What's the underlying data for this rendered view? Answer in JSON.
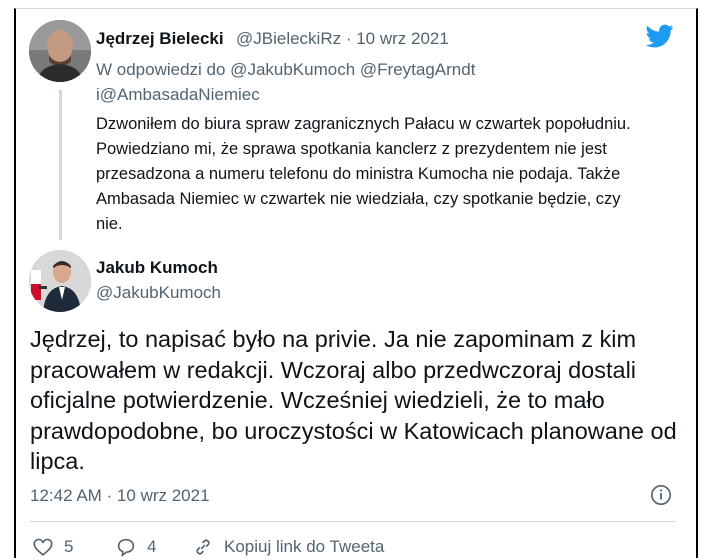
{
  "reply_tweet": {
    "author_name": "Jędrzej Bielecki",
    "meta": "@JBieleckiRz · 10 wrz 2021",
    "reply_line1": "W odpowiedzi do @JakubKumoch @FreytagArndt",
    "reply_line2": "i@AmbasadaNiemiec",
    "text": "Dzwoniłem do biura spraw zagranicznych Pałacu w czwartek popołudniu. Powiedziano mi, że sprawa spotkania kanclerz z prezydentem nie jest przesadzona a numeru telefonu do ministra Kumocha nie podaja. Także Ambasada Niemiec w czwartek nie wiedziała, czy spotkanie będzie, czy nie."
  },
  "main_tweet": {
    "author_name": "Jakub Kumoch",
    "handle": "@JakubKumoch",
    "text": "Jędrzej, to napisać było na privie. Ja nie zapominam z kim pracowałem w redakcji. Wczoraj albo przedwczoraj dostali oficjalne potwierdzenie. Wcześniej wiedzieli, że to mało prawdopodobne, bo uroczystości w Katowicach planowane od lipca.",
    "timestamp": "12:42 AM · 10 wrz 2021"
  },
  "actions": {
    "likes": "5",
    "replies": "4",
    "copy_link": "Kopiuj link do Tweeta"
  },
  "colors": {
    "twitter_blue": "#1d9bf0",
    "text": "#0f1419",
    "secondary": "#536471"
  }
}
